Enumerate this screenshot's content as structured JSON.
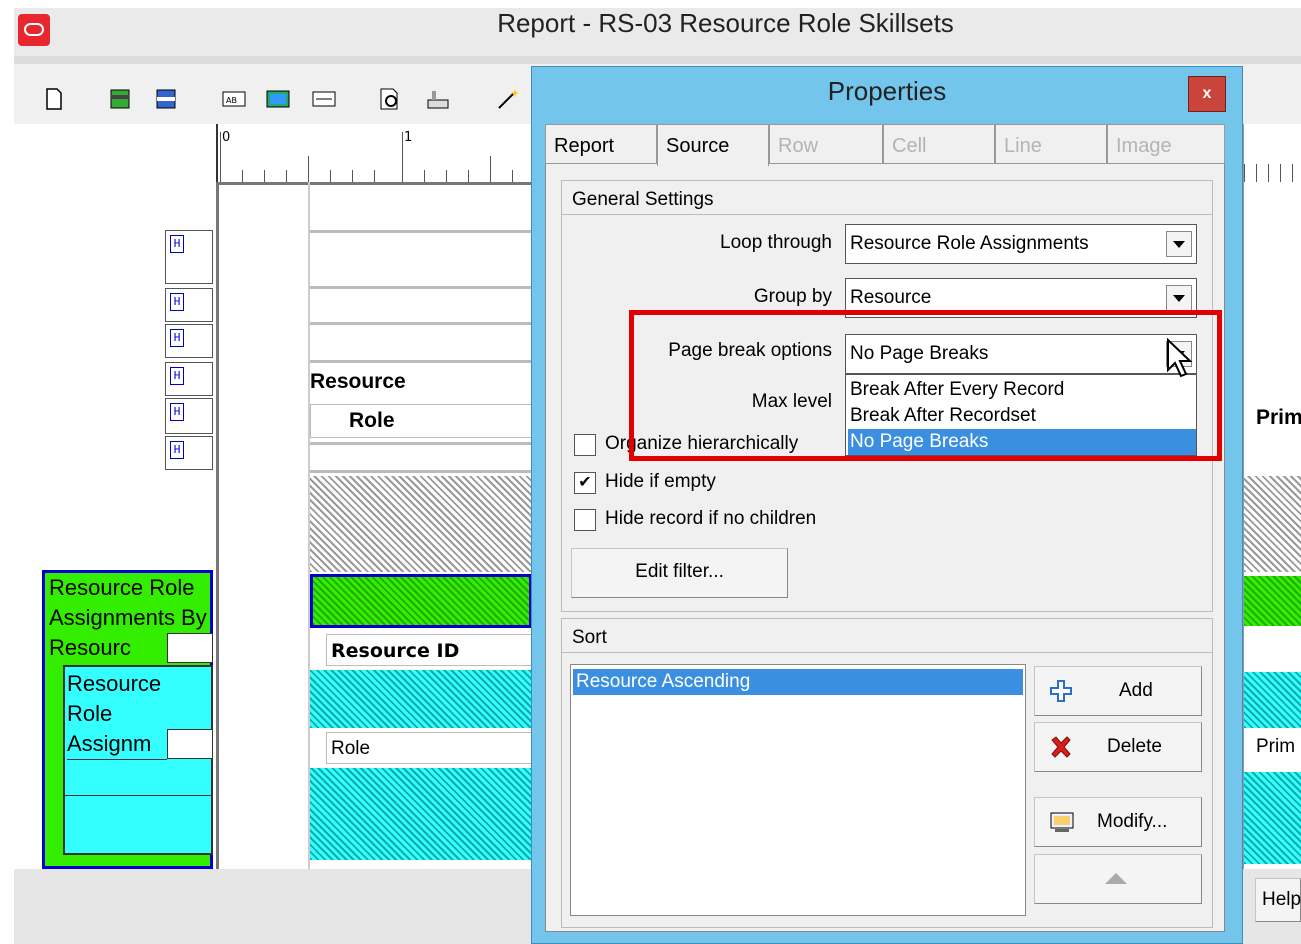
{
  "window": {
    "title": "Report - RS-03  Resource Role Skillsets",
    "logo": "oracle-logo"
  },
  "ruler": {
    "ticks": [
      "0",
      "1"
    ]
  },
  "layout": {
    "section_labels": [
      "Resource",
      "Role",
      "Resource ID",
      "Role"
    ],
    "side_panel": {
      "outer_label": "Resource Role Assignments By Resourc",
      "inner_label": "Resource Role Assignm"
    },
    "right_labels": [
      "Prim",
      "Prim",
      "Help"
    ]
  },
  "dialog": {
    "title": "Properties",
    "close_label": "x",
    "tabs": [
      {
        "label": "Report",
        "enabled": true,
        "active": false
      },
      {
        "label": "Source",
        "enabled": true,
        "active": true
      },
      {
        "label": "Row",
        "enabled": false,
        "active": false
      },
      {
        "label": "Cell",
        "enabled": false,
        "active": false
      },
      {
        "label": "Line",
        "enabled": false,
        "active": false
      },
      {
        "label": "Image",
        "enabled": false,
        "active": false
      }
    ],
    "general": {
      "header": "General Settings",
      "loop_through": {
        "label": "Loop through",
        "value": "Resource Role Assignments"
      },
      "group_by": {
        "label": "Group by",
        "value": "Resource"
      },
      "page_break": {
        "label": "Page break options",
        "value": "No Page Breaks",
        "options": [
          "Break After Every Record",
          "Break After Recordset",
          "No Page Breaks"
        ],
        "selected_option": "No Page Breaks"
      },
      "max_level": {
        "label": "Max level"
      },
      "organize": {
        "label": "Organize hierarchically",
        "checked": false
      },
      "hide_empty": {
        "label": "Hide if empty",
        "checked": true
      },
      "hide_no_children": {
        "label": "Hide record if no children",
        "checked": false
      },
      "edit_filter": "Edit filter..."
    },
    "sort": {
      "header": "Sort",
      "items": [
        "Resource Ascending"
      ],
      "add": "Add",
      "delete": "Delete",
      "modify": "Modify..."
    }
  },
  "colors": {
    "highlight": "#e00000",
    "dialog_frame": "#74c5ec",
    "selection": "#3b8fe0"
  }
}
